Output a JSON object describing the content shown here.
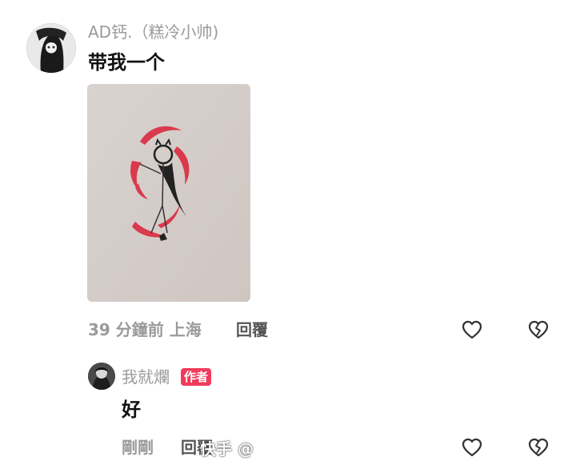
{
  "comment": {
    "username": "AD钙.（糕冷小帅)",
    "text": "带我一个",
    "meta_time_location": "39 分鐘前 上海",
    "reply_label": "回覆"
  },
  "reply": {
    "username": "我就爛",
    "author_badge": "作者",
    "text": "好",
    "meta_time": "剛剛",
    "reply_label": "回覆"
  },
  "watermark": {
    "text": "快手 @"
  },
  "icons": {
    "like": "heart-icon",
    "dislike": "broken-heart-icon"
  },
  "colors": {
    "badge": "#f23a5b",
    "muted_text": "#9a9a9a",
    "drawing_red": "#d93a4c"
  }
}
